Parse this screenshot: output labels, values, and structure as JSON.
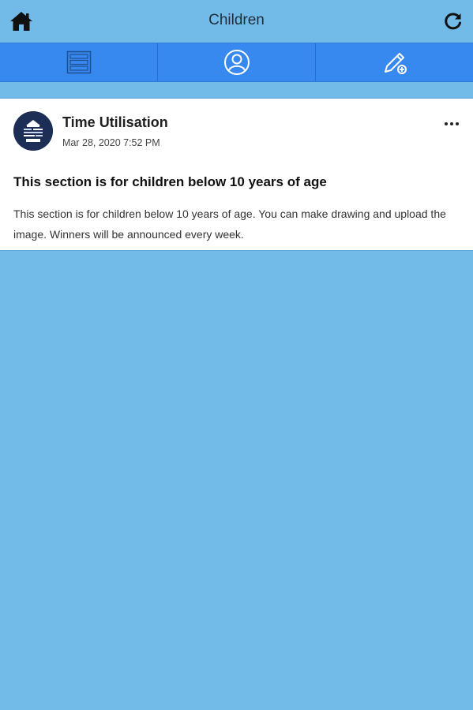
{
  "header": {
    "title": "Children",
    "home_icon": "home-icon",
    "refresh_icon": "refresh-icon"
  },
  "tabs": [
    {
      "icon": "list-icon"
    },
    {
      "icon": "user-circle-icon"
    },
    {
      "icon": "edit-pencil-icon"
    }
  ],
  "post": {
    "author": "Time Utilisation",
    "date": "Mar 28, 2020 7:52 PM",
    "title": "This section is for children below 10 years of age",
    "body": "This section is for children below 10 years of age. You can make drawing and upload the image. Winners will be announced every week."
  },
  "colors": {
    "background": "#72bbe9",
    "tabbar": "#3889ef",
    "card": "#ffffff"
  }
}
